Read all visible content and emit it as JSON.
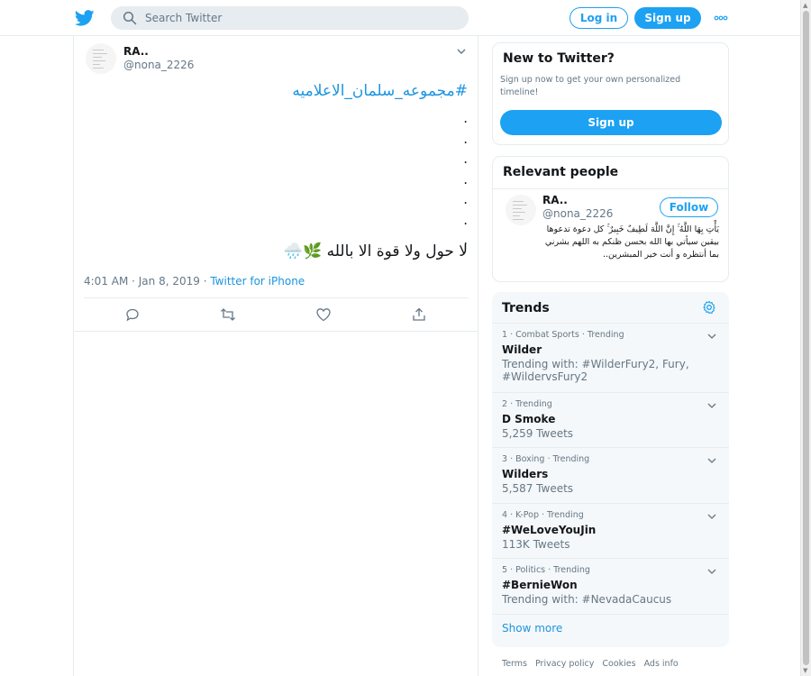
{
  "header": {
    "search_placeholder": "Search Twitter",
    "login_label": "Log in",
    "signup_label": "Sign up",
    "brand_color": "#1da1f2"
  },
  "tweet": {
    "author_name": "RA..",
    "author_handle": "@nona_2226",
    "hashtag": "#مجموعه_سلمان_الاعلاميه",
    "dots": [
      ".",
      ".",
      ".",
      ".",
      ".",
      ".",
      "."
    ],
    "body": "لا حول ولا قوة الا بالله 🌿🌧️",
    "time": "4:01 AM · Jan 8, 2019 · ",
    "source": "Twitter for iPhone",
    "actions": [
      "reply-icon",
      "retweet-icon",
      "like-icon",
      "share-icon"
    ]
  },
  "new_to_twitter": {
    "title": "New to Twitter?",
    "description": "Sign up now to get your own personalized timeline!",
    "signup_label": "Sign up"
  },
  "relevant_people": {
    "title": "Relevant people",
    "name": "RA..",
    "handle": "@nona_2226",
    "follow_label": "Follow",
    "bio": "يَأْتِ بِهَا اللَّهُ ۚ إِنَّ اللَّهَ لَطِيفٌ خَبِيرٌ ۚ كل دعوة تدعوها بيقين سيأتي بها الله بحسن ظنكم به اللهم بشرني بما أنتظره و أنت خير المبشرين.."
  },
  "trends": {
    "title": "Trends",
    "items": [
      {
        "context": "1 · Combat Sports · Trending",
        "name": "Wilder",
        "sub": "Trending with: #WilderFury2, Fury, #WildervsFury2"
      },
      {
        "context": "2 · Trending",
        "name": "D Smoke",
        "sub": "5,259 Tweets"
      },
      {
        "context": "3 · Boxing · Trending",
        "name": "Wilders",
        "sub": "5,587 Tweets"
      },
      {
        "context": "4 · K-Pop · Trending",
        "name": "#WeLoveYouJin",
        "sub": "113K Tweets"
      },
      {
        "context": "5 · Politics · Trending",
        "name": "#BernieWon",
        "sub": "Trending with: #NevadaCaucus"
      }
    ],
    "show_more": "Show more"
  },
  "footer": {
    "links": [
      "Terms",
      "Privacy policy",
      "Cookies",
      "Ads info"
    ]
  }
}
